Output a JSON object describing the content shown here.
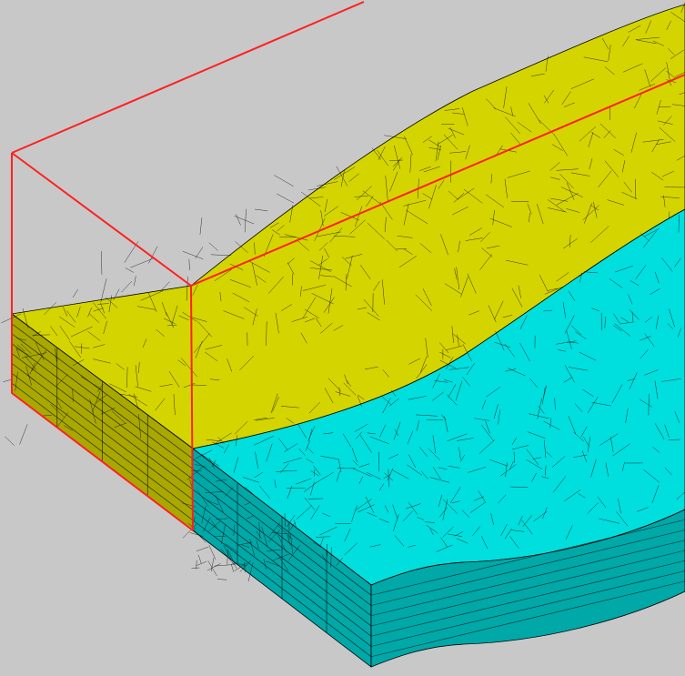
{
  "scene": {
    "description_label": "",
    "colors": {
      "background": "#c8c8c8",
      "yellow_top": "#d4d400",
      "yellow_side": "#a8a800",
      "cyan_top": "#00dede",
      "cyan_side": "#00a8a8",
      "bbox": "#ff0000",
      "mesh": "#000000"
    },
    "regions": [
      "yellow-domain",
      "cyan-domain"
    ],
    "layers_visible": 8
  }
}
